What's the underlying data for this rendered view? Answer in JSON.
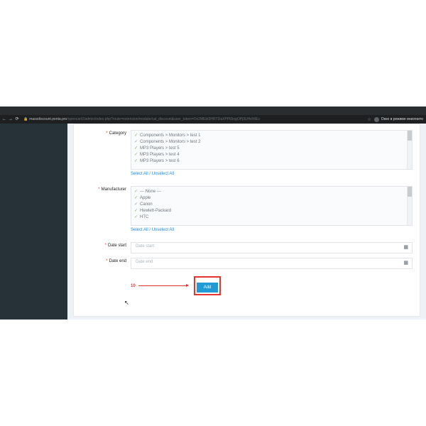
{
  "browser": {
    "url_host": "massdiscount.penta.pro",
    "url_path": "/opencart2/admin/index.php?route=extension/module/cat_discount&user_token=Ov2MEbt3HRTDaXPPI0iogOPj3UHeNlEu",
    "signin": "Окно в режиме инкогнито"
  },
  "symbols": {
    "req": "*"
  },
  "form": {
    "category": {
      "label": "Category",
      "items": [
        "Components > Monitors > test 1",
        "Components > Monitors > test 2",
        "MP3 Players > test 5",
        "MP3 Players > test 4",
        "MP3 Players > test 6"
      ]
    },
    "manufacturer": {
      "label": "Manufacturer",
      "items": [
        "--- None ---",
        "Apple",
        "Canon",
        "Hewlett-Packard",
        "HTC"
      ]
    },
    "select_all": "Select All",
    "unselect_all": "Unselect All",
    "date_start": {
      "label": "Date start",
      "placeholder": "Date start"
    },
    "date_end": {
      "label": "Date end",
      "placeholder": "Date end"
    },
    "add_button": "Add"
  },
  "annotation": {
    "step": "10"
  }
}
